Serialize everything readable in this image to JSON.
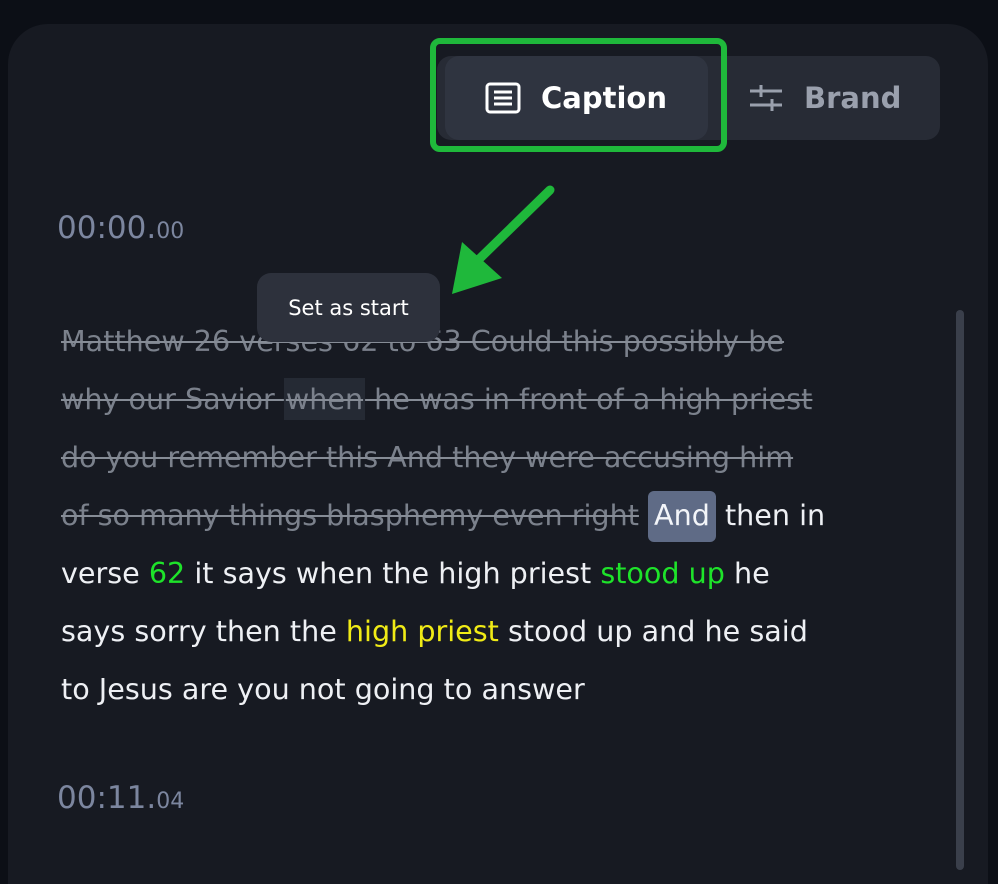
{
  "tabs": {
    "caption": {
      "label": "Caption",
      "icon": "document-lines-icon"
    },
    "brand": {
      "label": "Brand",
      "icon": "sliders-icon"
    }
  },
  "colors": {
    "highlight_box": "#1fb83b",
    "arrow": "#1fb83b",
    "keyword_green": "#1ee32a",
    "keyword_yellow": "#f0eb16"
  },
  "segments": [
    {
      "time_main": "00:00.",
      "time_frac": "00"
    },
    {
      "time_main": "00:11.",
      "time_frac": "04"
    }
  ],
  "tooltip": {
    "text": "Set as start"
  },
  "transcript": {
    "l1": "Matthew 26 verses 62 to 63 Could this possibly be",
    "l2a": "why our Savior ",
    "l2b": "when",
    "l2c": " he was in front of a high priest",
    "l3": "do you remember this And they were accusing him",
    "l4a": "of so many things blasphemy even right",
    "l4b": "And",
    "l4c": " then in",
    "l5a": "verse ",
    "l5b": "62",
    "l5c": " it says when the high priest ",
    "l5d": "stood up",
    "l5e": " he",
    "l6a": "says sorry then the ",
    "l6b": "high priest",
    "l6c": " stood up and he said",
    "l7": "to Jesus are you not going to answer"
  }
}
